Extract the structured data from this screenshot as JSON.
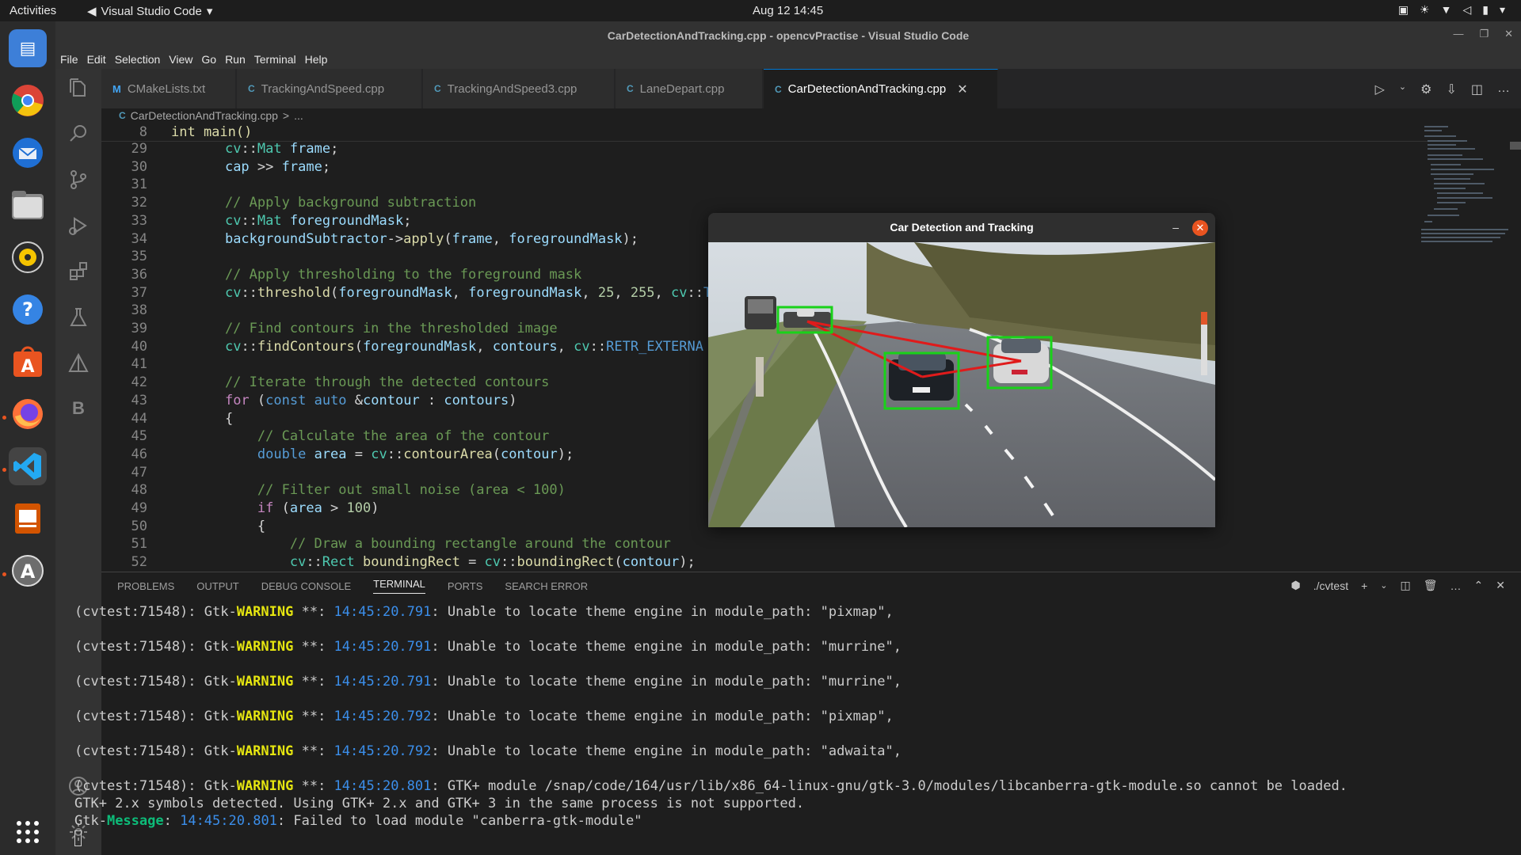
{
  "topbar": {
    "activities": "Activities",
    "app": "Visual Studio Code",
    "clock": "Aug 12  14:45"
  },
  "window": {
    "title": "CarDetectionAndTracking.cpp - opencvPractise - Visual Studio Code"
  },
  "menu": [
    "File",
    "Edit",
    "Selection",
    "View",
    "Go",
    "Run",
    "Terminal",
    "Help"
  ],
  "tabs": [
    {
      "label": "CMakeLists.txt",
      "icon": "M"
    },
    {
      "label": "TrackingAndSpeed.cpp",
      "icon": "G"
    },
    {
      "label": "TrackingAndSpeed3.cpp",
      "icon": "G"
    },
    {
      "label": "LaneDepart.cpp",
      "icon": "G"
    },
    {
      "label": "CarDetectionAndTracking.cpp",
      "icon": "G"
    }
  ],
  "breadcrumb": {
    "file": "CarDetectionAndTracking.cpp",
    "sep": ">",
    "more": "..."
  },
  "sticky": {
    "ln": "8",
    "text": "int main()"
  },
  "code_lines": [
    {
      "ln": "29",
      "text": "    cv::Mat frame;"
    },
    {
      "ln": "30",
      "text": "    cap >> frame;"
    },
    {
      "ln": "31",
      "text": ""
    },
    {
      "ln": "32",
      "text": "    // Apply background subtraction"
    },
    {
      "ln": "33",
      "text": "    cv::Mat foregroundMask;"
    },
    {
      "ln": "34",
      "text": "    backgroundSubtractor->apply(frame, foregroundMask);"
    },
    {
      "ln": "35",
      "text": ""
    },
    {
      "ln": "36",
      "text": "    // Apply thresholding to the foreground mask"
    },
    {
      "ln": "37",
      "text": "    cv::threshold(foregroundMask, foregroundMask, 25, 255, cv::T"
    },
    {
      "ln": "38",
      "text": ""
    },
    {
      "ln": "39",
      "text": "    // Find contours in the thresholded image"
    },
    {
      "ln": "40",
      "text": "    cv::findContours(foregroundMask, contours, cv::RETR_EXTERNA"
    },
    {
      "ln": "41",
      "text": ""
    },
    {
      "ln": "42",
      "text": "    // Iterate through the detected contours"
    },
    {
      "ln": "43",
      "text": "    for (const auto &contour : contours)"
    },
    {
      "ln": "44",
      "text": "    {"
    },
    {
      "ln": "45",
      "text": "        // Calculate the area of the contour"
    },
    {
      "ln": "46",
      "text": "        double area = cv::contourArea(contour);"
    },
    {
      "ln": "47",
      "text": ""
    },
    {
      "ln": "48",
      "text": "        // Filter out small noise (area < 100)"
    },
    {
      "ln": "49",
      "text": "        if (area > 100)"
    },
    {
      "ln": "50",
      "text": "        {"
    },
    {
      "ln": "51",
      "text": "            // Draw a bounding rectangle around the contour"
    },
    {
      "ln": "52",
      "text": "            cv::Rect boundingRect = cv::boundingRect(contour);"
    }
  ],
  "popup": {
    "title": "Car Detection and Tracking",
    "minimize": "–",
    "close": "✕"
  },
  "panel_tabs": [
    "PROBLEMS",
    "OUTPUT",
    "DEBUG CONSOLE",
    "TERMINAL",
    "PORTS",
    "SEARCH ERROR"
  ],
  "terminal_name": "./cvtest",
  "terminal": [
    {
      "pre": "(cvtest:71548): Gtk-",
      "kind": "WARNING",
      "mid": " **: ",
      "ts": "14:45:20.791",
      "post": ": Unable to locate theme engine in module_path: \"pixmap\","
    },
    {
      "pre": "(cvtest:71548): Gtk-",
      "kind": "WARNING",
      "mid": " **: ",
      "ts": "14:45:20.791",
      "post": ": Unable to locate theme engine in module_path: \"murrine\","
    },
    {
      "pre": "(cvtest:71548): Gtk-",
      "kind": "WARNING",
      "mid": " **: ",
      "ts": "14:45:20.791",
      "post": ": Unable to locate theme engine in module_path: \"murrine\","
    },
    {
      "pre": "(cvtest:71548): Gtk-",
      "kind": "WARNING",
      "mid": " **: ",
      "ts": "14:45:20.792",
      "post": ": Unable to locate theme engine in module_path: \"pixmap\","
    },
    {
      "pre": "(cvtest:71548): Gtk-",
      "kind": "WARNING",
      "mid": " **: ",
      "ts": "14:45:20.792",
      "post": ": Unable to locate theme engine in module_path: \"adwaita\","
    },
    {
      "pre": "(cvtest:71548): Gtk-",
      "kind": "WARNING",
      "mid": " **: ",
      "ts": "14:45:20.801",
      "post": ": GTK+ module /snap/code/164/usr/lib/x86_64-linux-gnu/gtk-3.0/modules/libcanberra-gtk-module.so cannot be loaded."
    }
  ],
  "terminal_extra": {
    "line2": "GTK+ 2.x symbols detected. Using GTK+ 2.x and GTK+ 3 in the same process is not supported.",
    "msg_pre": "Gtk-",
    "msg_kind": "Message",
    "msg_ts": "14:45:20.801",
    "msg_post": ": Failed to load module \"canberra-gtk-module\""
  }
}
